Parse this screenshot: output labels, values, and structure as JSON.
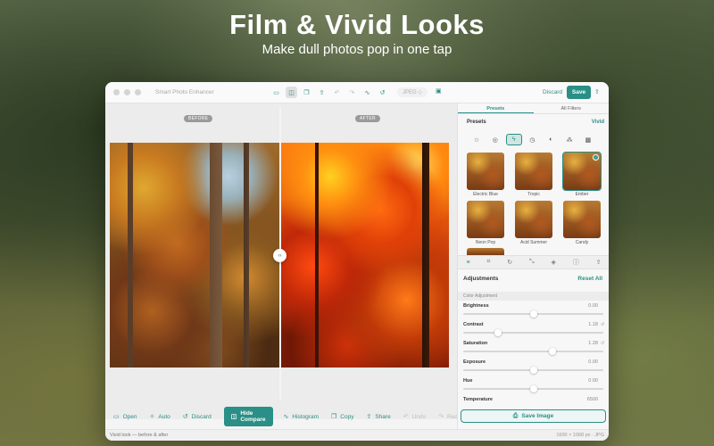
{
  "hero": {
    "title": "Film & Vivid Looks",
    "subtitle": "Make dull photos pop in one tap"
  },
  "window": {
    "app_title": "Smart Photo Enhancer",
    "format": "JPEG ◇",
    "discard_label": "Discard",
    "save_label": "Save"
  },
  "canvas": {
    "before_label": "BEFORE",
    "after_label": "AFTER"
  },
  "bottombar": {
    "open": "Open",
    "auto": "Auto",
    "discard": "Discard",
    "hide_compare": "Hide Compare",
    "histogram": "Histogram",
    "copy": "Copy",
    "share": "Share",
    "undo": "Undo",
    "redo": "Redo"
  },
  "status": {
    "left": "Vivid look — before & after",
    "right": "1600 × 1068 px · JPG"
  },
  "panel": {
    "tabs": [
      "Presets",
      "All Filters"
    ],
    "presets_title": "Presets",
    "presets_category": "Vivid",
    "presets": [
      {
        "name": "Electric Blue",
        "selected": false
      },
      {
        "name": "Tropic",
        "selected": false
      },
      {
        "name": "Ember",
        "selected": true
      },
      {
        "name": "Neon Pop",
        "selected": false
      },
      {
        "name": "Acid Summer",
        "selected": false
      },
      {
        "name": "Candy",
        "selected": false
      }
    ],
    "adjustments_title": "Adjustments",
    "reset_all": "Reset All",
    "section": "Color Adjustment",
    "sliders": [
      {
        "name": "Brightness",
        "value": "0.00",
        "fraction": 0.5
      },
      {
        "name": "Contrast",
        "value": "1.18",
        "fraction": 0.25
      },
      {
        "name": "Saturation",
        "value": "1.28",
        "fraction": 0.64
      },
      {
        "name": "Exposure",
        "value": "0.00",
        "fraction": 0.5
      },
      {
        "name": "Hue",
        "value": "0.00",
        "fraction": 0.5
      },
      {
        "name": "Temperature",
        "value": "6500",
        "fraction": 0.5
      }
    ],
    "save_image": "Save Image"
  },
  "colors": {
    "accent": "#2a8f86"
  }
}
